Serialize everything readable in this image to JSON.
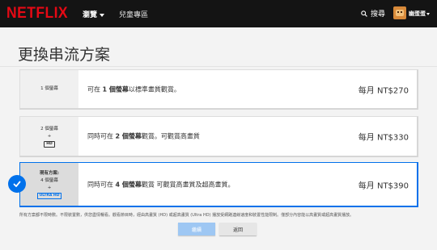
{
  "nav": {
    "logo": "NETFLIX",
    "browse": "瀏覽",
    "kids": "兒童專區",
    "search": "搜尋",
    "profile": "幽蛋蛋",
    "icons": [
      "search-icon",
      "avatar",
      "caret-down-icon"
    ]
  },
  "title": "更換串流方案",
  "plans": [
    {
      "screens": "1 個螢幕",
      "desc_pre": "可在 ",
      "desc_bold": "1 個螢幕",
      "desc_post": "以標準畫質觀賞。",
      "price": "每月 NT$270"
    },
    {
      "screens": "2 個螢幕",
      "plus": "+",
      "badge": "HD",
      "desc_pre": "同時可在 ",
      "desc_bold": "2 個螢幕",
      "desc_post": "觀賞。可觀賞高畫質",
      "price": "每月 NT$330"
    },
    {
      "current": "現有方案:",
      "screens": "4 個螢幕",
      "plus": "+",
      "badge": "ULTRA HD",
      "desc_pre": "同時可在 ",
      "desc_bold": "4 個螢幕",
      "desc_post": "觀賞 可觀賞高畫質及超高畫質。",
      "price": "每月 NT$390",
      "selected": true
    }
  ],
  "footnote": "所有方案都不限時數。不限裝置數，供您盡情暢看。觀看節目時，經由高畫質 (HD) 或超高畫質 (Ultra HD) 播放受網路連線速度和裝置性能限制。僅部分內容能以高畫質或超高畫質播放。",
  "buttons": {
    "continue": "繼續",
    "back": "返回"
  },
  "colors": {
    "brand": "#e50914",
    "accent": "#0071eb",
    "nav_bg": "#141414"
  }
}
